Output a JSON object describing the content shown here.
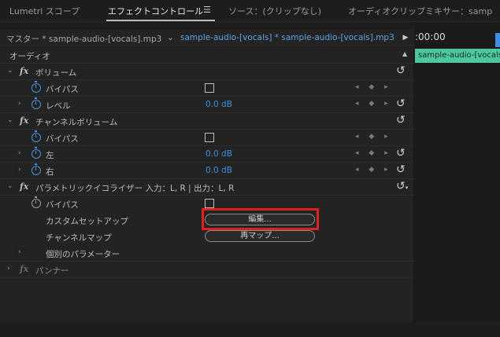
{
  "tabs": [
    {
      "label": "Lumetri スコープ"
    },
    {
      "label": "エフェクトコントロール"
    },
    {
      "label": "ソース：(クリップなし)"
    },
    {
      "label": "オーディオクリップミキサー：samp"
    }
  ],
  "panel_menu_icon": "hamburger-icon",
  "header": {
    "master_label": "マスター * sample-audio-[vocals].mp3",
    "chevron": "⌄",
    "clip_label": "sample-audio-[vocals] * sample-audio-[vocals].mp3"
  },
  "timeline": {
    "timecode": ":00:00",
    "clip_label": "sample-audio-[vocals]",
    "clip_color": "#4fc79d",
    "playhead_color": "#3e8ee8"
  },
  "section_label": "オーディオ",
  "effects": {
    "volume": {
      "title": "ボリューム",
      "bypass_label": "バイパス",
      "level_label": "レベル",
      "level_value": "0.0 dB"
    },
    "channel_volume": {
      "title": "チャンネルボリューム",
      "bypass_label": "バイパス",
      "left_label": "左",
      "left_value": "0.0 dB",
      "right_label": "右",
      "right_value": "0.0 dB"
    },
    "parametric_eq": {
      "title": "パラメトリックイコライザー 入力：L, R | 出力：L, R",
      "bypass_label": "バイパス",
      "custom_setup_label": "カスタムセットアップ",
      "edit_button": "編集...",
      "channel_map_label": "チャンネルマップ",
      "remap_button": "再マップ...",
      "individual_params_label": "個別のパラメーター"
    },
    "panner": {
      "title": "パンナー"
    }
  },
  "fx_label": "fx",
  "keyframe_nav": "◂ ◆ ▸",
  "reset_glyph": "↺",
  "colors": {
    "accent_blue": "#3a8fe0",
    "highlight_red": "#e01f1f"
  }
}
